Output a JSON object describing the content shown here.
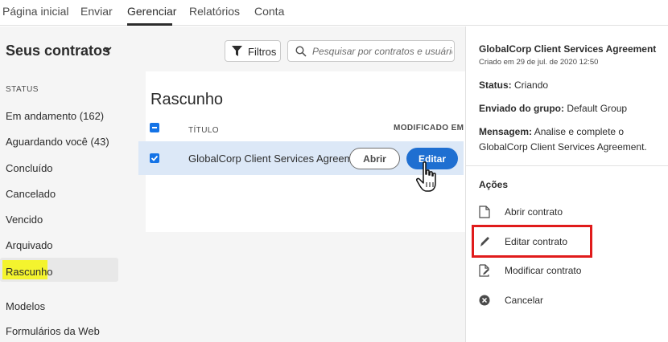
{
  "nav": {
    "tabs": [
      {
        "label": "Página inicial"
      },
      {
        "label": "Enviar"
      },
      {
        "label": "Gerenciar"
      },
      {
        "label": "Relatórios"
      },
      {
        "label": "Conta"
      }
    ],
    "active": "Gerenciar"
  },
  "header": {
    "title": "Seus contratos",
    "filters_label": "Filtros",
    "search_placeholder": "Pesquisar por contratos e usuários..."
  },
  "sidebar": {
    "status_label": "STATUS",
    "items": [
      {
        "label": "Em andamento (162)"
      },
      {
        "label": "Aguardando você (43)"
      },
      {
        "label": "Concluído"
      },
      {
        "label": "Cancelado"
      },
      {
        "label": "Vencido"
      },
      {
        "label": "Arquivado"
      },
      {
        "label": "Rascunho"
      },
      {
        "label": "Modelos"
      },
      {
        "label": "Formulários da Web"
      }
    ],
    "selected": "Rascunho"
  },
  "main": {
    "title": "Rascunho",
    "col_title": "TÍTULO",
    "col_modified": "MODIFICADO EM",
    "rows": [
      {
        "title": "GlobalCorp Client Services Agreement",
        "open_label": "Abrir",
        "edit_label": "Editar"
      }
    ]
  },
  "details": {
    "title": "GlobalCorp Client Services Agreement",
    "created": "Criado em 29 de jul. de 2020 12:50",
    "status_key": "Status:",
    "status_val": "Criando",
    "group_key": "Enviado do grupo:",
    "group_val": "Default Group",
    "message_key": "Mensagem:",
    "message_val": "Analise e complete o GlobalCorp Client Services Agreement.",
    "actions_label": "Ações",
    "actions": [
      {
        "label": "Abrir contrato",
        "icon": "document-icon"
      },
      {
        "label": "Editar contrato",
        "icon": "pencil-icon"
      },
      {
        "label": "Modificar contrato",
        "icon": "document-edit-icon"
      },
      {
        "label": "Cancelar",
        "icon": "cancel-circle-icon"
      }
    ]
  },
  "colors": {
    "accent": "#1473e6",
    "highlight": "#f4f42e",
    "callout": "#e01b1b"
  }
}
